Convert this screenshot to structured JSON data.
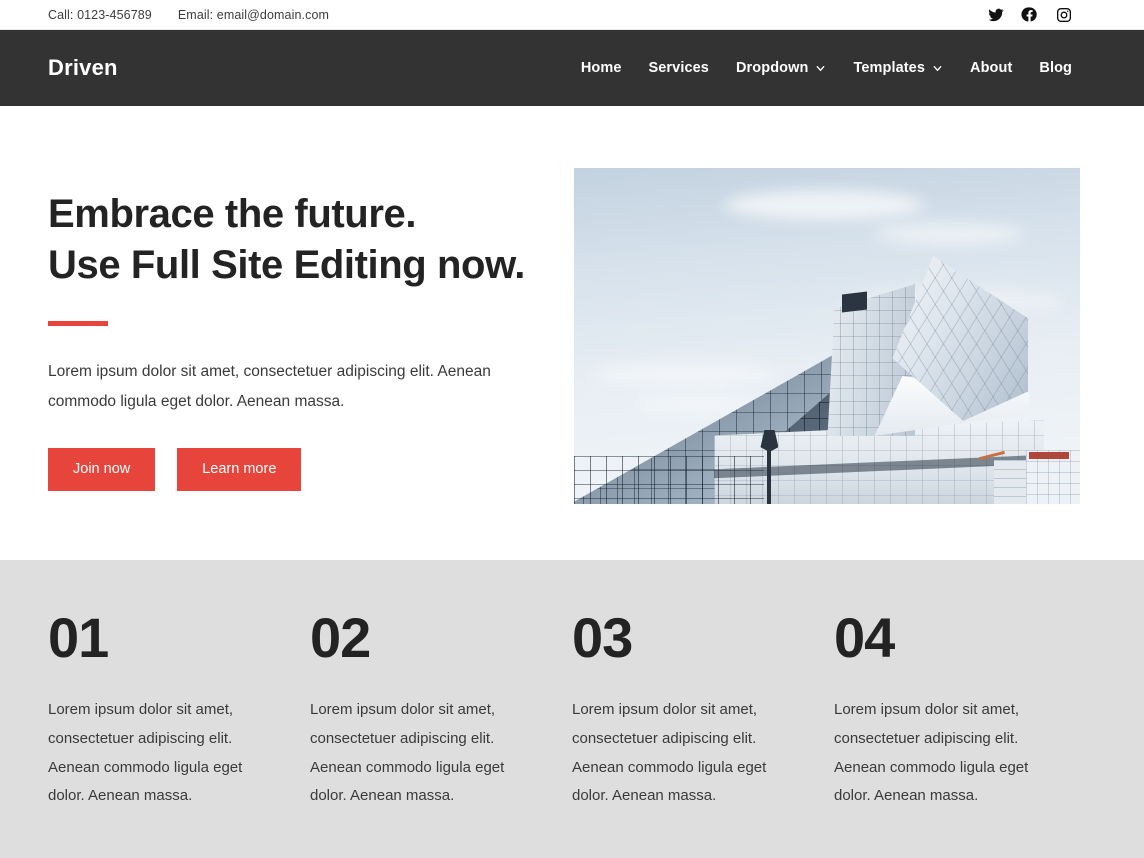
{
  "topbar": {
    "phone": "Call: 0123-456789",
    "email": "Email: email@domain.com",
    "social": [
      {
        "name": "twitter-icon",
        "label": "Twitter"
      },
      {
        "name": "facebook-icon",
        "label": "Facebook"
      },
      {
        "name": "instagram-icon",
        "label": "Instagram"
      }
    ]
  },
  "header": {
    "logo": "Driven",
    "background_color": "#333333",
    "nav": [
      {
        "label": "Home",
        "has_dropdown": false
      },
      {
        "label": "Services",
        "has_dropdown": false
      },
      {
        "label": "Dropdown",
        "has_dropdown": true
      },
      {
        "label": "Templates",
        "has_dropdown": true
      },
      {
        "label": "About",
        "has_dropdown": false
      },
      {
        "label": "Blog",
        "has_dropdown": false
      }
    ]
  },
  "hero": {
    "title_line1": "Embrace the future.",
    "title_line2": "Use Full Site Editing now.",
    "divider_color": "#e7453b",
    "paragraph": "Lorem ipsum dolor sit amet, consectetuer adipiscing elit. Aenean commodo ligula eget dolor. Aenean massa.",
    "primary_button": "Join now",
    "secondary_button": "Learn more",
    "accent_color": "#e7453b",
    "image_alt": "Modern angular glass museum building against a pale sky"
  },
  "stats": {
    "background_color": "#dedede",
    "cards": [
      {
        "number": "01",
        "text": "Lorem ipsum dolor sit amet, consectetuer adipiscing elit. Aenean commodo ligula eget dolor. Aenean massa."
      },
      {
        "number": "02",
        "text": "Lorem ipsum dolor sit amet, consectetuer adipiscing elit. Aenean commodo ligula eget dolor. Aenean massa."
      },
      {
        "number": "03",
        "text": "Lorem ipsum dolor sit amet, consectetuer adipiscing elit. Aenean commodo ligula eget dolor. Aenean massa."
      },
      {
        "number": "04",
        "text": "Lorem ipsum dolor sit amet, consectetuer adipiscing elit. Aenean commodo ligula eget dolor. Aenean massa."
      }
    ]
  }
}
